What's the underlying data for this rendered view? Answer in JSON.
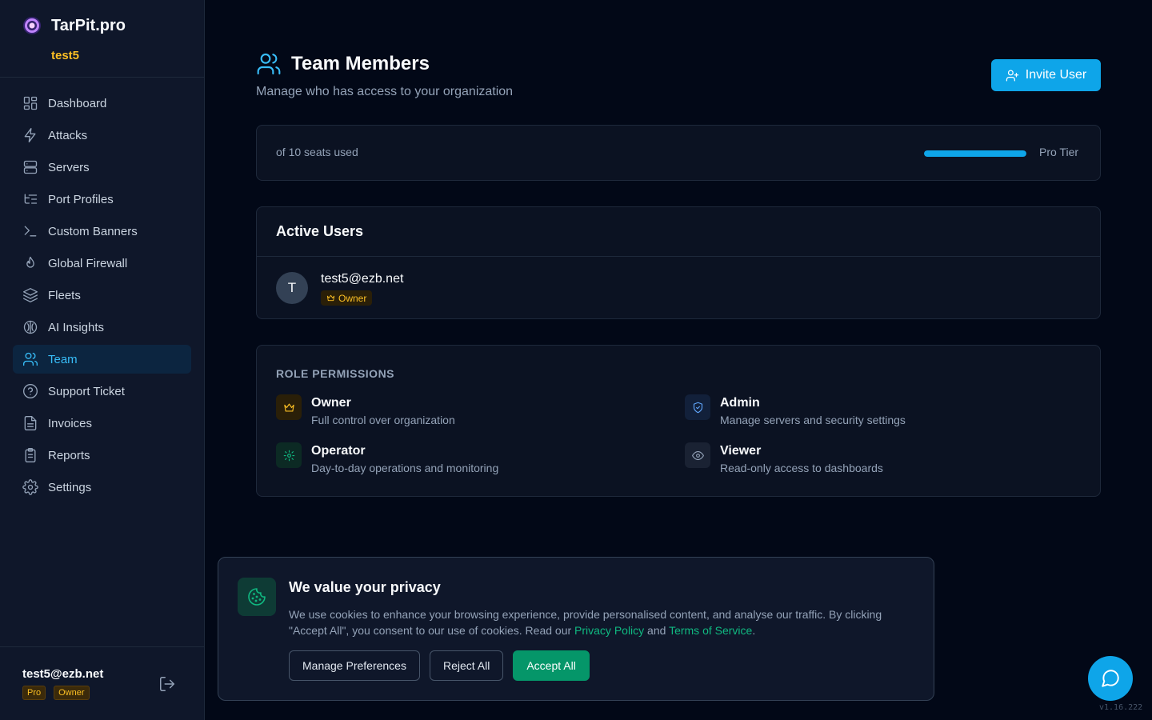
{
  "brand": {
    "name": "TarPit.pro",
    "org": "test5"
  },
  "sidebar": {
    "items": [
      {
        "label": "Dashboard",
        "icon": "dashboard-icon"
      },
      {
        "label": "Attacks",
        "icon": "lightning-icon"
      },
      {
        "label": "Servers",
        "icon": "server-icon"
      },
      {
        "label": "Port Profiles",
        "icon": "list-tree-icon"
      },
      {
        "label": "Custom Banners",
        "icon": "terminal-icon"
      },
      {
        "label": "Global Firewall",
        "icon": "flame-icon"
      },
      {
        "label": "Fleets",
        "icon": "layers-icon"
      },
      {
        "label": "AI Insights",
        "icon": "brain-icon"
      },
      {
        "label": "Team",
        "icon": "users-icon",
        "active": true
      },
      {
        "label": "Support Ticket",
        "icon": "help-circle-icon"
      },
      {
        "label": "Invoices",
        "icon": "file-text-icon"
      },
      {
        "label": "Reports",
        "icon": "clipboard-icon"
      },
      {
        "label": "Settings",
        "icon": "gear-icon"
      }
    ],
    "user": {
      "email": "test5@ezb.net",
      "plan": "Pro",
      "role": "Owner"
    }
  },
  "header": {
    "title": "Team Members",
    "subtitle": "Manage who has access to your organization",
    "invite_label": "Invite User"
  },
  "seats": {
    "text": "of 10 seats used",
    "tier": "Pro Tier",
    "progress": 1.0
  },
  "active_users": {
    "title": "Active Users",
    "members": [
      {
        "initial": "T",
        "email": "test5@ezb.net",
        "role": "Owner"
      }
    ]
  },
  "roles": {
    "heading": "ROLE PERMISSIONS",
    "items": [
      {
        "name": "Owner",
        "desc": "Full control over organization",
        "icon": "crown-icon",
        "color": "#fbbf24"
      },
      {
        "name": "Admin",
        "desc": "Manage servers and security settings",
        "icon": "shield-icon",
        "color": "#60a5fa"
      },
      {
        "name": "Operator",
        "desc": "Day-to-day operations and monitoring",
        "icon": "gear-icon",
        "color": "#10b981"
      },
      {
        "name": "Viewer",
        "desc": "Read-only access to dashboards",
        "icon": "eye-icon",
        "color": "#94a3b8"
      }
    ]
  },
  "cookie": {
    "title": "We value your privacy",
    "text_before": "We use cookies to enhance your browsing experience, provide personalised content, and analyse our traffic. By clicking \"Accept All\", you consent to our use of cookies. Read our ",
    "privacy_link": "Privacy Policy",
    "and": " and ",
    "terms_link": "Terms of Service",
    "period": ".",
    "manage_label": "Manage Preferences",
    "reject_label": "Reject All",
    "accept_label": "Accept All"
  },
  "version": "v1.16.222",
  "colors": {
    "accent": "#0ea5e9",
    "owner": "#fbbf24",
    "success": "#10b981"
  }
}
